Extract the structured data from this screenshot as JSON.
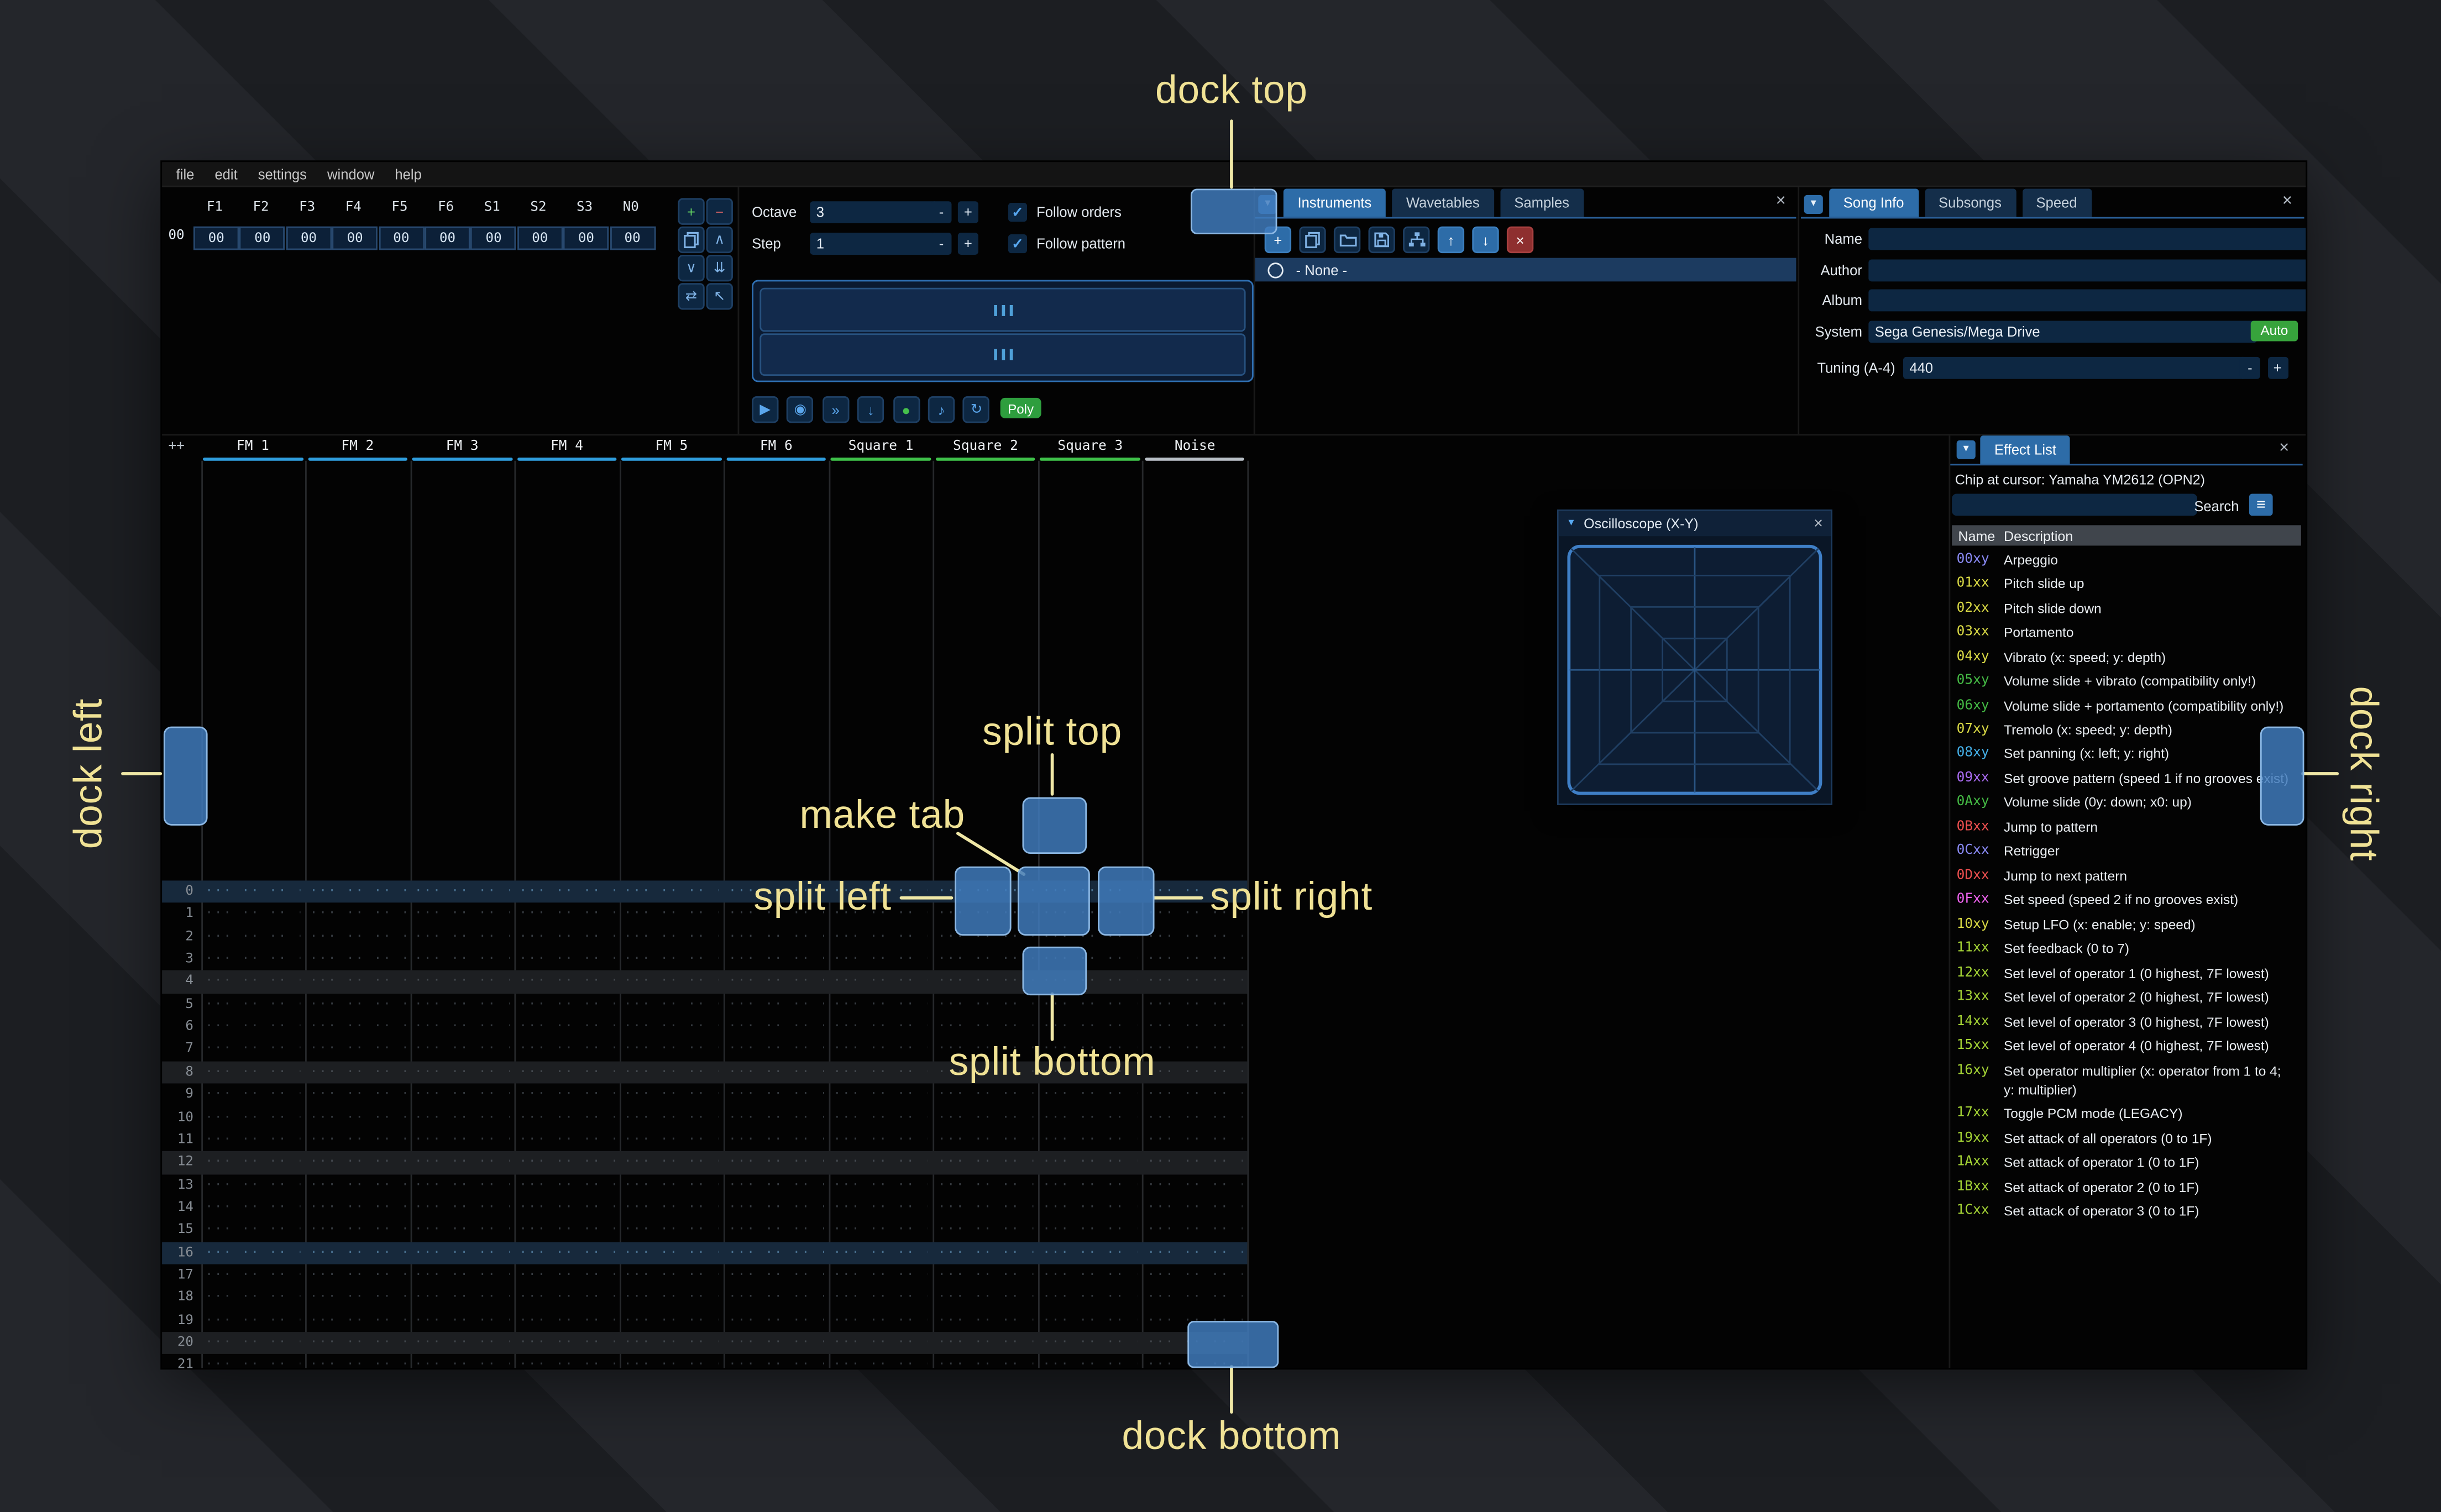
{
  "annotations": {
    "dock_top": "dock top",
    "dock_left": "dock left",
    "dock_right": "dock right",
    "dock_bottom": "dock bottom",
    "split_top": "split top",
    "split_left": "split left",
    "split_right": "split right",
    "split_bottom": "split bottom",
    "make_tab": "make tab"
  },
  "menu": {
    "items": [
      "file",
      "edit",
      "settings",
      "window",
      "help"
    ]
  },
  "orders": {
    "index": "00",
    "channels": [
      "F1",
      "F2",
      "F3",
      "F4",
      "F5",
      "F6",
      "S1",
      "S2",
      "S3",
      "N0"
    ],
    "values": [
      "00",
      "00",
      "00",
      "00",
      "00",
      "00",
      "00",
      "00",
      "00",
      "00"
    ]
  },
  "controls": {
    "octave_label": "Octave",
    "octave_value": "3",
    "step_label": "Step",
    "step_value": "1",
    "minus": "-",
    "plus": "+",
    "follow_orders_label": "Follow orders",
    "follow_pattern_label": "Follow pattern",
    "poly_label": "Poly"
  },
  "instruments": {
    "tabs": [
      "Instruments",
      "Wavetables",
      "Samples"
    ],
    "active_tab": "Instruments",
    "list": [
      "- None -"
    ]
  },
  "song_info": {
    "tabs": [
      "Song Info",
      "Subsongs",
      "Speed"
    ],
    "active_tab": "Song Info",
    "name_label": "Name",
    "name_value": "",
    "author_label": "Author",
    "author_value": "",
    "album_label": "Album",
    "album_value": "",
    "system_label": "System",
    "system_value": "Sega Genesis/Mega Drive",
    "auto_label": "Auto",
    "tuning_label": "Tuning (A-4)",
    "tuning_value": "440"
  },
  "pattern": {
    "corner_label": "++",
    "channels": [
      {
        "name": "FM 1",
        "color": "#2f9ede"
      },
      {
        "name": "FM 2",
        "color": "#2f9ede"
      },
      {
        "name": "FM 3",
        "color": "#2f9ede"
      },
      {
        "name": "FM 4",
        "color": "#2f9ede"
      },
      {
        "name": "FM 5",
        "color": "#2f9ede"
      },
      {
        "name": "FM 6",
        "color": "#2f9ede"
      },
      {
        "name": "Square 1",
        "color": "#3fc24a"
      },
      {
        "name": "Square 2",
        "color": "#3fc24a"
      },
      {
        "name": "Square 3",
        "color": "#3fc24a"
      },
      {
        "name": "Noise",
        "color": "#b9c0c7"
      }
    ],
    "row_numbers": [
      "0",
      "1",
      "2",
      "3",
      "4",
      "5",
      "6",
      "7",
      "8",
      "9",
      "10",
      "11",
      "12",
      "13",
      "14",
      "15",
      "16",
      "17",
      "18",
      "19",
      "20",
      "21"
    ],
    "empty_cell": "··· ·· ·· ···"
  },
  "oscilloscope": {
    "title": "Oscilloscope (X-Y)"
  },
  "effect_list": {
    "title": "Effect List",
    "chip_info": "Chip at cursor: Yamaha YM2612 (OPN2)",
    "search_value": "",
    "search_label": "Search",
    "name_header": "Name",
    "description_header": "Description",
    "effects": [
      {
        "code": "00xy",
        "color": "#8a8af5",
        "description": "Arpeggio"
      },
      {
        "code": "01xx",
        "color": "#d9d945",
        "description": "Pitch slide up"
      },
      {
        "code": "02xx",
        "color": "#d9d945",
        "description": "Pitch slide down"
      },
      {
        "code": "03xx",
        "color": "#d9d945",
        "description": "Portamento"
      },
      {
        "code": "04xy",
        "color": "#d9d945",
        "description": "Vibrato (x: speed; y: depth)"
      },
      {
        "code": "05xy",
        "color": "#44b944",
        "description": "Volume slide + vibrato (compatibility only!)"
      },
      {
        "code": "06xy",
        "color": "#44b944",
        "description": "Volume slide + portamento (compatibility only!)"
      },
      {
        "code": "07xy",
        "color": "#d9d945",
        "description": "Tremolo (x: speed; y: depth)"
      },
      {
        "code": "08xy",
        "color": "#45b0e8",
        "description": "Set panning (x: left; y: right)"
      },
      {
        "code": "09xx",
        "color": "#aa6cf2",
        "description": "Set groove pattern (speed 1 if no grooves exist)"
      },
      {
        "code": "0Axy",
        "color": "#44b944",
        "description": "Volume slide (0y: down; x0: up)"
      },
      {
        "code": "0Bxx",
        "color": "#ef5050",
        "description": "Jump to pattern"
      },
      {
        "code": "0Cxx",
        "color": "#8a8af5",
        "description": "Retrigger"
      },
      {
        "code": "0Dxx",
        "color": "#ef5050",
        "description": "Jump to next pattern"
      },
      {
        "code": "0Fxx",
        "color": "#ee63ee",
        "description": "Set speed (speed 2 if no grooves exist)"
      },
      {
        "code": "10xy",
        "color": "#d9d945",
        "description": "Setup LFO (x: enable; y: speed)"
      },
      {
        "code": "11xx",
        "color": "#a3d235",
        "description": "Set feedback (0 to 7)"
      },
      {
        "code": "12xx",
        "color": "#a3d235",
        "description": "Set level of operator 1 (0 highest, 7F lowest)"
      },
      {
        "code": "13xx",
        "color": "#a3d235",
        "description": "Set level of operator 2 (0 highest, 7F lowest)"
      },
      {
        "code": "14xx",
        "color": "#a3d235",
        "description": "Set level of operator 3 (0 highest, 7F lowest)"
      },
      {
        "code": "15xx",
        "color": "#a3d235",
        "description": "Set level of operator 4 (0 highest, 7F lowest)"
      },
      {
        "code": "16xy",
        "color": "#a3d235",
        "description": "Set operator multiplier (x: operator from 1 to 4; y: multiplier)"
      },
      {
        "code": "17xx",
        "color": "#a3d235",
        "description": "Toggle PCM mode (LEGACY)"
      },
      {
        "code": "19xx",
        "color": "#a3d235",
        "description": "Set attack of all operators (0 to 1F)"
      },
      {
        "code": "1Axx",
        "color": "#a3d235",
        "description": "Set attack of operator 1 (0 to 1F)"
      },
      {
        "code": "1Bxx",
        "color": "#a3d235",
        "description": "Set attack of operator 2 (0 to 1F)"
      },
      {
        "code": "1Cxx",
        "color": "#a3d235",
        "description": "Set attack of operator 3 (0 to 1F)"
      }
    ]
  }
}
